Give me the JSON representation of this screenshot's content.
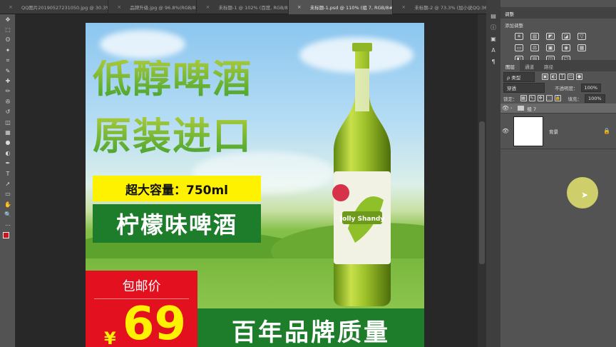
{
  "tabs": [
    {
      "label": "QQ图片20190527231050.jpg @ 30.3%(...",
      "active": false
    },
    {
      "label": "品牌升级.jpg @ 96.8%(RGB/8...",
      "active": false
    },
    {
      "label": "未标题-1 @ 102% (百度, RGB/8...",
      "active": false
    },
    {
      "label": "未标题-1.psd @ 110% (组 7, RGB/8#) ×",
      "active": true
    },
    {
      "label": "未标题-2 @ 73.3% (加小说QQ:3618066...",
      "active": false
    }
  ],
  "tab_more": "»",
  "toolbar": {
    "tools": [
      "move-icon",
      "marquee-icon",
      "lasso-icon",
      "magic-wand-icon",
      "crop-icon",
      "eyedropper-icon",
      "healing-icon",
      "brush-icon",
      "stamp-icon",
      "history-brush-icon",
      "eraser-icon",
      "gradient-icon",
      "blur-icon",
      "dodge-icon",
      "pen-icon",
      "type-icon",
      "path-select-icon",
      "shape-icon",
      "hand-icon",
      "zoom-icon",
      "more-icon"
    ],
    "tool_glyphs": [
      "✥",
      "⬚",
      "ʘ",
      "✦",
      "⌗",
      "✎",
      "✚",
      "✏",
      "✇",
      "↺",
      "◫",
      "▦",
      "●",
      "◐",
      "✒",
      "T",
      "➚",
      "▭",
      "✋",
      "🔍",
      "⋯"
    ],
    "fg_color": "#d0121b",
    "bg_color": "#111111"
  },
  "poster": {
    "headline_1": "低醇啤酒",
    "headline_2": "原装进口",
    "capacity": "超大容量：750ml",
    "flavor": "柠檬味啤酒",
    "free_shipping": "包邮价",
    "price": "69",
    "currency": "¥",
    "quality": "百年品牌质量",
    "bottle_label_text": "Jolly Shandy",
    "colors": {
      "green": "#1d7d2b",
      "yellow": "#fff200",
      "red": "#e3101f"
    }
  },
  "right_panel": {
    "side_glyphs": [
      "▤",
      "ⓘ",
      "▣",
      "A",
      "¶"
    ],
    "adjust_header": "调整",
    "adjust_title": "添加调整",
    "adjust_icons": [
      "☀",
      "▥",
      "◩",
      "◪",
      "▽",
      "▭",
      "⚖",
      "▣",
      "◉",
      "▦",
      "◧",
      "▨",
      "◫",
      "◱"
    ],
    "layers_tabs": [
      "图层",
      "通道",
      "路径"
    ],
    "kind_label": "ρ 类型",
    "kind_icons": [
      "▣",
      "◐",
      "T",
      "⊡",
      "●"
    ],
    "blend_mode": "穿透",
    "opacity_label": "不透明度：",
    "opacity_value": "100%",
    "lock_label": "锁定：",
    "lock_icons": [
      "▦",
      "✎",
      "✥",
      "⬚",
      "🔒"
    ],
    "fill_label": "填充：",
    "fill_value": "100%",
    "layers": [
      {
        "name": "组 7",
        "type": "group"
      },
      {
        "name": "背景",
        "type": "background"
      }
    ]
  }
}
